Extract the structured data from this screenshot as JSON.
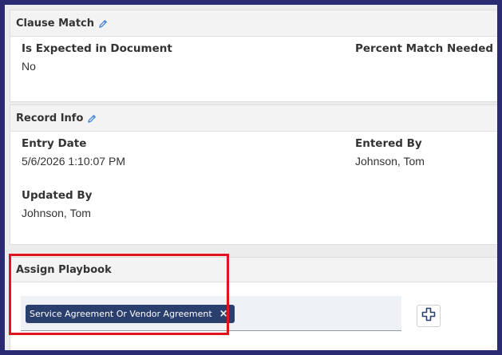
{
  "clause_match": {
    "title": "Clause Match",
    "fields": [
      {
        "label": "Is Expected in Document",
        "value": "No"
      },
      {
        "label": "Percent Match Needed",
        "value": ""
      }
    ]
  },
  "record_info": {
    "title": "Record Info",
    "entry_date": {
      "label": "Entry Date",
      "value": "5/6/2026 1:10:07 PM"
    },
    "entered_by": {
      "label": "Entered By",
      "value": "Johnson, Tom"
    },
    "updated_by": {
      "label": "Updated By",
      "value": "Johnson, Tom"
    }
  },
  "assign_playbook": {
    "title": "Assign Playbook",
    "tags": [
      {
        "label": "Service Agreement Or Vendor Agreement",
        "remove_symbol": "×"
      }
    ],
    "add_icon": "plus-icon"
  },
  "icons": {
    "edit": "pencil-icon"
  },
  "colors": {
    "highlight": "#e0141e",
    "tag_bg": "#2a3f6e",
    "edit_icon": "#3a7fd5",
    "frame_border": "#2a2a72"
  }
}
